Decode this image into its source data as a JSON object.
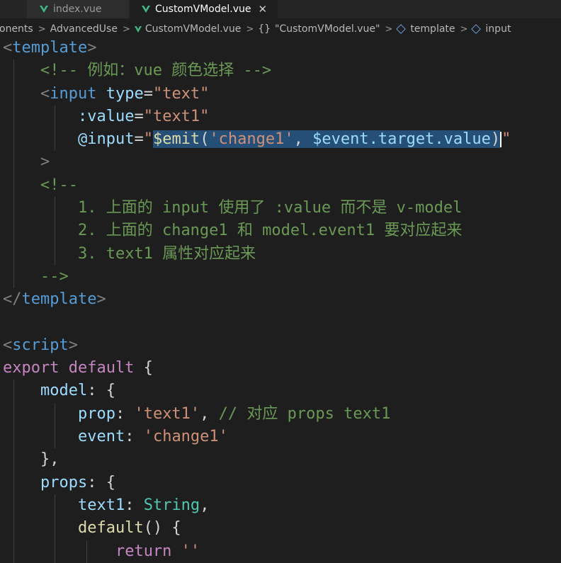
{
  "tabs": [
    {
      "label": "index.vue",
      "active": false
    },
    {
      "label": "CustomVModel.vue",
      "active": true
    }
  ],
  "breadcrumb": {
    "items": [
      "onents",
      "AdvancedUse",
      "CustomVModel.vue",
      "\"CustomVModel.vue\"",
      "template",
      "input"
    ]
  },
  "code": {
    "l1": {
      "t1": "<",
      "t2": "template",
      "t3": ">"
    },
    "l2": {
      "comment": "<!-- 例如：vue 颜色选择 -->"
    },
    "l3": {
      "t1": "<",
      "t2": "input",
      "sp": " ",
      "a1": "type",
      "eq": "=",
      "s1": "\"text\""
    },
    "l4": {
      "a1": ":value",
      "eq": "=",
      "s1": "\"text1\""
    },
    "l5": {
      "a1": "@input",
      "eq": "=",
      "q1": "\"",
      "sel1": "$emit",
      "sel2": "(",
      "sel3": "'change1'",
      "sel4": ", ",
      "sel5": "$event.target.value",
      "sel6": ")",
      "q2": "\""
    },
    "l6": {
      "t1": ">"
    },
    "l7": {
      "comment": "<!--"
    },
    "l8": {
      "comment": "1. 上面的 input 使用了 :value 而不是 v-model"
    },
    "l9": {
      "comment": "2. 上面的 change1 和 model.event1 要对应起来"
    },
    "l10": {
      "comment": "3. text1 属性对应起来"
    },
    "l11": {
      "comment": "-->"
    },
    "l12": {
      "t1": "</",
      "t2": "template",
      "t3": ">"
    },
    "l14": {
      "t1": "<",
      "t2": "script",
      "t3": ">"
    },
    "l15": {
      "k1": "export default",
      "d1": " {"
    },
    "l16": {
      "a1": "model",
      "d1": ": {"
    },
    "l17": {
      "a1": "prop",
      "d1": ": ",
      "s1": "'text1'",
      "d2": ", ",
      "c1": "// 对应 props text1"
    },
    "l18": {
      "a1": "event",
      "d1": ": ",
      "s1": "'change1'"
    },
    "l19": {
      "d1": "},"
    },
    "l20": {
      "a1": "props",
      "d1": ": {"
    },
    "l21": {
      "a1": "text1",
      "d1": ": ",
      "ty1": "String",
      "d2": ","
    },
    "l22": {
      "f1": "default",
      "d1": "() {"
    },
    "l23": {
      "k1": "return",
      "s1": " ''"
    }
  },
  "colors": {
    "background": "#1e1e1e",
    "tag": "#569cd6",
    "attribute": "#9cdcfe",
    "string": "#ce9178",
    "comment": "#6a9955",
    "keyword": "#c586c0",
    "function": "#dcdcaa",
    "type": "#4ec9b0",
    "selection": "#264f78",
    "vue-icon": "#41b883"
  }
}
